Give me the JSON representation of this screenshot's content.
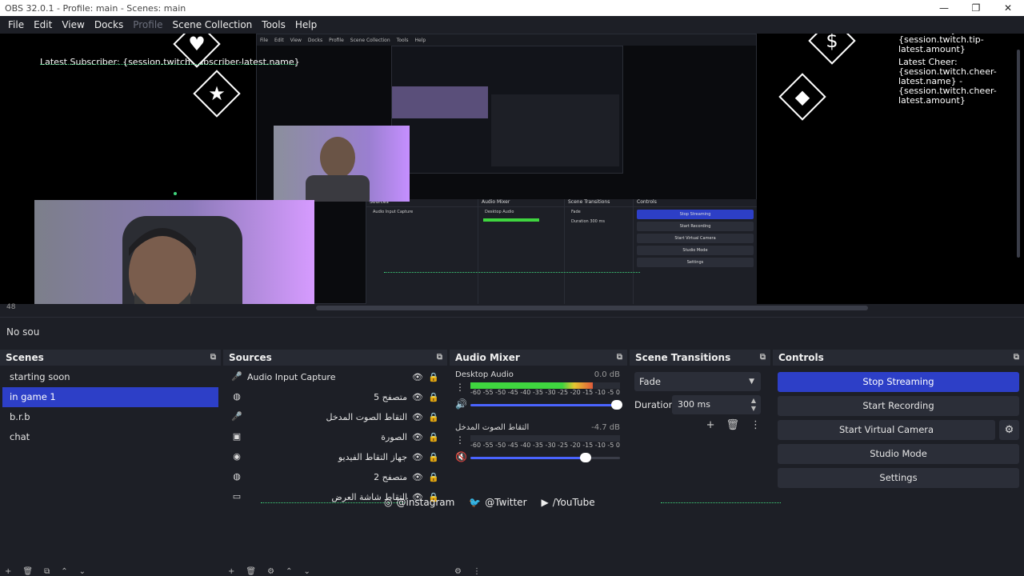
{
  "window": {
    "title": "OBS 32.0.1 - Profile: main - Scenes: main",
    "minimize": "—",
    "restore": "❐",
    "close": "✕"
  },
  "menu": {
    "items": [
      "File",
      "Edit",
      "View",
      "Docks",
      "Profile",
      "Scene Collection",
      "Tools",
      "Help"
    ]
  },
  "preview": {
    "latest_subscriber": "Latest Subscriber: {session.twitch.subscriber-latest.name}",
    "tip_text": "{session.twitch.tip-latest.name} - {session.twitch.tip-latest.amount}",
    "cheer_title": "Latest Cheer:",
    "cheer_text": "{session.twitch.cheer-latest.name} - {session.twitch.cheer-latest.amount}",
    "zoom": "48",
    "no_source": "No sou",
    "nested_menu": [
      "File",
      "Edit",
      "View",
      "Docks",
      "Profile",
      "Scene Collection",
      "Tools",
      "Help"
    ],
    "nested_docks": {
      "sources": "Sources",
      "audio_mixer": "Audio Mixer",
      "scene_transitions": "Scene Transitions",
      "controls": "Controls",
      "audio_input": "Audio Input Capture",
      "desktop_audio": "Desktop Audio",
      "fade": "Fade",
      "duration": "Duration",
      "duration_value": "300 ms",
      "controls_buttons": [
        "Stop Streaming",
        "Start Recording",
        "Start Virtual Camera",
        "Studio Mode",
        "Settings"
      ]
    },
    "icons": {
      "heart": "♥",
      "star": "★",
      "dollar": "$",
      "gem": "◆"
    }
  },
  "scenes": {
    "title": "Scenes",
    "items": [
      "starting soon",
      "in game 1",
      "b.r.b",
      "chat"
    ],
    "selected_index": 1,
    "footer_icons": [
      "+",
      "🗑",
      "⧉",
      "⌃",
      "⌄"
    ]
  },
  "sources": {
    "title": "Sources",
    "items": [
      {
        "label": "Audio Input Capture",
        "icon": "microphone-icon",
        "glyph": "🎤",
        "rtl": false
      },
      {
        "label": "متصفح 5",
        "icon": "globe-icon",
        "glyph": "◍",
        "rtl": true
      },
      {
        "label": "التقاط الصوت المدخل",
        "icon": "microphone-icon",
        "glyph": "🎤",
        "rtl": true
      },
      {
        "label": "الصورة",
        "icon": "image-icon",
        "glyph": "▣",
        "rtl": true
      },
      {
        "label": "جهاز التقاط الفيديو",
        "icon": "camera-icon",
        "glyph": "◉",
        "rtl": true
      },
      {
        "label": "متصفح 2",
        "icon": "globe-icon",
        "glyph": "◍",
        "rtl": true
      },
      {
        "label": "التقاط شاشة العرض",
        "icon": "monitor-icon",
        "glyph": "▭",
        "rtl": true
      }
    ],
    "eye": "👁",
    "lock": "🔒",
    "footer_icons": [
      "+",
      "🗑",
      "⚙",
      "⌃",
      "⌄"
    ]
  },
  "audio_mixer": {
    "title": "Audio Mixer",
    "tracks": [
      {
        "name": "Desktop Audio",
        "db": "0.0 dB",
        "level": 0.82,
        "muted": false,
        "volume": 0.98,
        "color": "#3fd53f"
      },
      {
        "name": "التقاط الصوت المدخل",
        "db": "-4.7 dB",
        "level": 0.0,
        "muted": true,
        "volume": 0.77,
        "color": "#3fd53f"
      }
    ],
    "scale": [
      "-60",
      "-55",
      "-50",
      "-45",
      "-40",
      "-35",
      "-30",
      "-25",
      "-20",
      "-15",
      "-10",
      "-5",
      "0"
    ],
    "footer_icons": [
      "⚙",
      "⋮"
    ]
  },
  "scene_transitions": {
    "title": "Scene Transitions",
    "selected": "Fade",
    "duration_label": "Duration",
    "duration_value": "300 ms",
    "tools": [
      "+",
      "🗑",
      "⋮"
    ]
  },
  "controls": {
    "title": "Controls",
    "stop_streaming": "Stop Streaming",
    "start_recording": "Start Recording",
    "start_virtual_camera": "Start Virtual Camera",
    "studio_mode": "Studio Mode",
    "settings": "Settings",
    "gear": "⚙"
  },
  "socials": {
    "instagram": "@instagram",
    "twitter": "@Twitter",
    "youtube": "/YouTube"
  },
  "colors": {
    "accent": "#2d3fc7",
    "panel": "#1d1f26",
    "header": "#272a33",
    "button": "#2b2e38",
    "neon": "#3fd57c"
  }
}
